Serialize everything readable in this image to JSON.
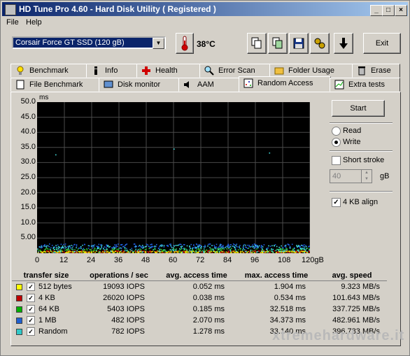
{
  "app": {
    "title": "HD Tune Pro 4.60 - Hard Disk Utility ( Registered )"
  },
  "menu": [
    {
      "label": "File"
    },
    {
      "label": "Help"
    }
  ],
  "toolbar": {
    "drive": "Corsair Force GT SSD     (120 gB)",
    "temperature": "38°C",
    "exit_label": "Exit"
  },
  "tabs_row1": [
    {
      "label": "Benchmark",
      "icon": "lightbulb-icon"
    },
    {
      "label": "Info",
      "icon": "info-icon"
    },
    {
      "label": "Health",
      "icon": "health-cross-icon"
    },
    {
      "label": "Error Scan",
      "icon": "magnifier-icon"
    },
    {
      "label": "Folder Usage",
      "icon": "folder-icon"
    },
    {
      "label": "Erase",
      "icon": "trash-icon"
    }
  ],
  "tabs_row2": [
    {
      "label": "File Benchmark",
      "icon": "file-icon"
    },
    {
      "label": "Disk monitor",
      "icon": "disk-monitor-icon"
    },
    {
      "label": "AAM",
      "icon": "speaker-icon"
    },
    {
      "label": "Random Access",
      "icon": "random-access-icon",
      "active": true
    },
    {
      "label": "Extra tests",
      "icon": "extra-tests-icon"
    }
  ],
  "controls": {
    "start_label": "Start",
    "read_label": "Read",
    "write_label": "Write",
    "mode_selected": "Write",
    "short_stroke_label": "Short stroke",
    "short_stroke_checked": false,
    "short_stroke_value": "40",
    "short_stroke_unit": "gB",
    "align_label": "4 KB align",
    "align_checked": true
  },
  "chart_data": {
    "type": "scatter",
    "y_unit_label": "ms",
    "ylim": [
      0,
      50
    ],
    "yticks": [
      "50.0",
      "45.0",
      "40.0",
      "35.0",
      "30.0",
      "25.0",
      "20.0",
      "15.0",
      "10.0",
      "5.00"
    ],
    "xlim": [
      0,
      120
    ],
    "xticks": [
      "0",
      "12",
      "24",
      "36",
      "48",
      "60",
      "72",
      "84",
      "96",
      "108",
      "120gB"
    ],
    "grid": true,
    "background": "#000000",
    "grid_color": "#4a4a4a",
    "series": [
      {
        "name": "512 bytes",
        "color": "#e8e800",
        "band_ms": [
          0.0,
          0.6
        ]
      },
      {
        "name": "4 KB",
        "color": "#d00000",
        "band_ms": [
          0.0,
          0.8
        ]
      },
      {
        "name": "64 KB",
        "color": "#30c030",
        "band_ms": [
          0.2,
          1.6
        ]
      },
      {
        "name": "1 MB",
        "color": "#2060e0",
        "band_ms": [
          1.5,
          3.0
        ]
      },
      {
        "name": "Random",
        "color": "#40d8d8",
        "band_ms": [
          0.2,
          2.6
        ]
      }
    ],
    "outliers": [
      {
        "x": 7,
        "y": 1.9
      },
      {
        "x": 8,
        "y": 32.5
      },
      {
        "x": 60,
        "y": 34.4
      },
      {
        "x": 102,
        "y": 33.1
      }
    ]
  },
  "table": {
    "headers": [
      "transfer size",
      "operations / sec",
      "avg. access time",
      "max. access time",
      "avg. speed"
    ],
    "rows": [
      {
        "color": "#ffff00",
        "size": "512 bytes",
        "ops": "19093 IOPS",
        "avg": "0.052 ms",
        "max": "1.904 ms",
        "speed": "9.323 MB/s"
      },
      {
        "color": "#c00000",
        "size": "4 KB",
        "ops": "26020 IOPS",
        "avg": "0.038 ms",
        "max": "0.534 ms",
        "speed": "101.643 MB/s"
      },
      {
        "color": "#00b000",
        "size": "64 KB",
        "ops": "5403 IOPS",
        "avg": "0.185 ms",
        "max": "32.518 ms",
        "speed": "337.725 MB/s"
      },
      {
        "color": "#2060d0",
        "size": "1 MB",
        "ops": "482 IOPS",
        "avg": "2.070 ms",
        "max": "34.373 ms",
        "speed": "482.961 MB/s"
      },
      {
        "color": "#30c8c8",
        "size": "Random",
        "ops": "782 IOPS",
        "avg": "1.278 ms",
        "max": "33.140 ms",
        "speed": "396.783 MB/s"
      }
    ]
  },
  "watermark": "xtremehardware.it"
}
